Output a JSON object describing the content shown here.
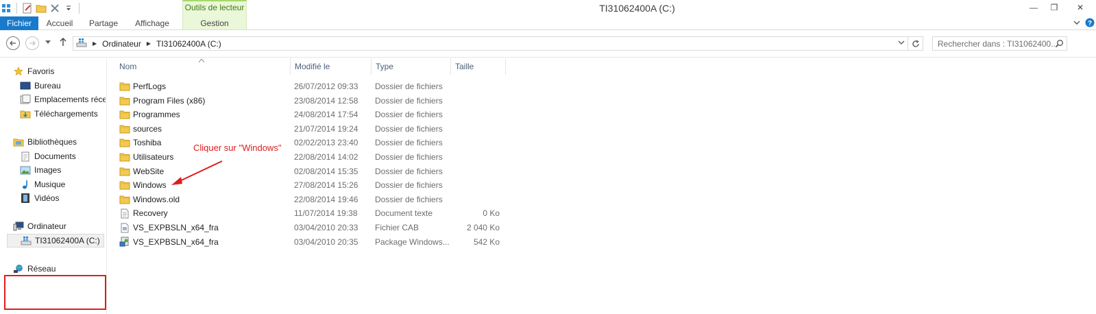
{
  "window": {
    "title": "TI31062400A (C:)",
    "context_tab_group": "Outils de lecteur",
    "minimize_glyph": "—",
    "maximize_glyph": "❐",
    "close_glyph": "✕"
  },
  "ribbon": {
    "tabs": [
      "Fichier",
      "Accueil",
      "Partage",
      "Affichage",
      "Gestion"
    ]
  },
  "address": {
    "crumbs": [
      "Ordinateur",
      "TI31062400A (C:)"
    ],
    "search_placeholder": "Rechercher dans : TI31062400..."
  },
  "nav": {
    "favorites_header": "Favoris",
    "favorites": [
      "Bureau",
      "Emplacements récents",
      "Téléchargements"
    ],
    "libraries_header": "Bibliothèques",
    "libraries": [
      "Documents",
      "Images",
      "Musique",
      "Vidéos"
    ],
    "computer_header": "Ordinateur",
    "computer_items": [
      "TI31062400A (C:)"
    ],
    "network_header": "Réseau"
  },
  "columns": [
    "Nom",
    "Modifié le",
    "Type",
    "Taille"
  ],
  "files": [
    {
      "name": "PerfLogs",
      "date": "26/07/2012 09:33",
      "type": "Dossier de fichiers",
      "size": "",
      "icon": "folder-icon"
    },
    {
      "name": "Program Files (x86)",
      "date": "23/08/2014 12:58",
      "type": "Dossier de fichiers",
      "size": "",
      "icon": "folder-icon"
    },
    {
      "name": "Programmes",
      "date": "24/08/2014 17:54",
      "type": "Dossier de fichiers",
      "size": "",
      "icon": "folder-icon"
    },
    {
      "name": "sources",
      "date": "21/07/2014 19:24",
      "type": "Dossier de fichiers",
      "size": "",
      "icon": "folder-icon"
    },
    {
      "name": "Toshiba",
      "date": "02/02/2013 23:40",
      "type": "Dossier de fichiers",
      "size": "",
      "icon": "folder-icon"
    },
    {
      "name": "Utilisateurs",
      "date": "22/08/2014 14:02",
      "type": "Dossier de fichiers",
      "size": "",
      "icon": "folder-icon"
    },
    {
      "name": "WebSite",
      "date": "02/08/2014 15:35",
      "type": "Dossier de fichiers",
      "size": "",
      "icon": "folder-icon"
    },
    {
      "name": "Windows",
      "date": "27/08/2014 15:26",
      "type": "Dossier de fichiers",
      "size": "",
      "icon": "folder-icon"
    },
    {
      "name": "Windows.old",
      "date": "22/08/2014 19:46",
      "type": "Dossier de fichiers",
      "size": "",
      "icon": "folder-icon"
    },
    {
      "name": "Recovery",
      "date": "11/07/2014 19:38",
      "type": "Document texte",
      "size": "0 Ko",
      "icon": "text-file-icon"
    },
    {
      "name": "VS_EXPBSLN_x64_fra",
      "date": "03/04/2010 20:33",
      "type": "Fichier CAB",
      "size": "2 040 Ko",
      "icon": "cab-file-icon"
    },
    {
      "name": "VS_EXPBSLN_x64_fra",
      "date": "03/04/2010 20:35",
      "type": "Package Windows...",
      "size": "542 Ko",
      "icon": "installer-package-icon"
    }
  ],
  "annotation": {
    "text": "Cliquer sur \"Windows\"",
    "color": "#e01b1b"
  },
  "colors": {
    "file_tab": "#1979ca",
    "context_tab": "#eaf7d8",
    "annotation": "#e01b1b"
  }
}
